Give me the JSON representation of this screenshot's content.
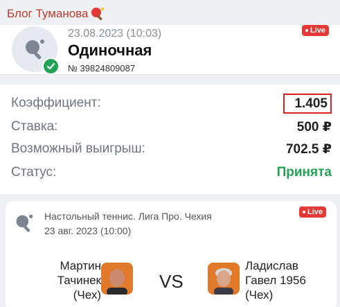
{
  "channel": {
    "title": "Блог Туманова"
  },
  "bet": {
    "datetime": "23.08.2023 (10:03)",
    "type": "Одиночная",
    "number": "№ 39824809087",
    "live_label": "Live"
  },
  "details": [
    {
      "label": "Коэффициент:",
      "value": "1.405"
    },
    {
      "label": "Ставка:",
      "value": "500 ₽"
    },
    {
      "label": "Возможный выигрыш:",
      "value": "702.5 ₽"
    },
    {
      "label": "Статус:",
      "value": "Принята"
    }
  ],
  "event": {
    "league": "Настольный теннис. Лига Про. Чехия",
    "datetime": "23 авг. 2023 (10:00)",
    "live_label": "Live",
    "player1": {
      "line1": "Мартин",
      "line2": "Тачинек",
      "line3": "(Чех)"
    },
    "player2": {
      "line1": "Ладислав",
      "line2": "Гавел 1956",
      "line3": "(Чех)"
    },
    "vs": "VS"
  },
  "colors": {
    "accent_red": "#e53935",
    "status_green": "#23a455",
    "channel_red": "#c0392b"
  },
  "icons": {
    "sport": "table-tennis-icon",
    "status": "check-icon"
  }
}
